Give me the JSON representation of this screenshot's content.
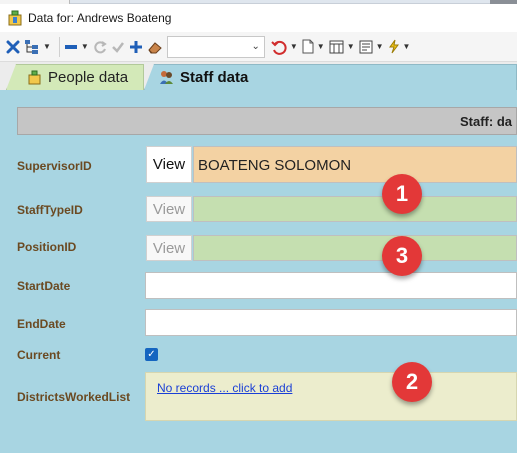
{
  "window": {
    "title": "Data for: Andrews Boateng"
  },
  "toolbar": {
    "combo_value": ""
  },
  "tabs": [
    {
      "label": "People data",
      "active": false
    },
    {
      "label": "Staff data",
      "active": true
    }
  ],
  "section": {
    "header": "Staff: da"
  },
  "form": {
    "supervisor": {
      "label": "SupervisorID",
      "view_label": "View",
      "value": "BOATENG SOLOMON"
    },
    "stafftype": {
      "label": "StaffTypeID",
      "view_label": "View",
      "value": ""
    },
    "position": {
      "label": "PositionID",
      "view_label": "View",
      "value": ""
    },
    "startdate": {
      "label": "StartDate",
      "value": ""
    },
    "enddate": {
      "label": "EndDate",
      "value": ""
    },
    "current": {
      "label": "Current",
      "checked": true
    },
    "districts": {
      "label": "DistrictsWorkedList",
      "link": "No records ... click to add"
    }
  },
  "badges": [
    "1",
    "2",
    "3"
  ],
  "colors": {
    "background": "#a8d5e2",
    "supervisor_field": "#f3d2a3",
    "lookup_field": "#c5dfb0",
    "label_text": "#6b4a22",
    "badge": "#e33838",
    "link": "#1a3fd6"
  }
}
